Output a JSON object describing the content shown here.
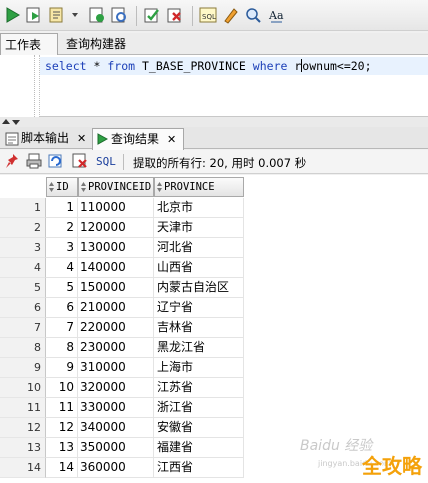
{
  "toolbar": {
    "icons": [
      "run-statement-icon",
      "run-script-icon",
      "explain-plan-icon",
      "autotrace-icon",
      "sql-tuning-icon",
      "commit-icon",
      "rollback-icon",
      "sql-history-icon",
      "clear-icon",
      "find-icon",
      "case-icon"
    ]
  },
  "editor_tabs": [
    {
      "label": "工作表"
    },
    {
      "label": "查询构建器"
    }
  ],
  "editor": {
    "kw_select": "select",
    "star": "*",
    "kw_from": "from",
    "table": "T_BASE_PROVINCE",
    "kw_where": "where",
    "cond_pre": "r",
    "cond_post": "ownum<=20;"
  },
  "output_tabs": [
    {
      "label": "脚本输出",
      "closable": true
    },
    {
      "label": "查询结果",
      "closable": true
    }
  ],
  "result_toolbar": {
    "sql_label": "SQL",
    "status": "提取的所有行: 20, 用时 0.007 秒"
  },
  "grid": {
    "columns": [
      "ID",
      "PROVINCEID",
      "PROVINCE"
    ],
    "rows": [
      {
        "n": "1",
        "id": "1",
        "pid": "110000",
        "name": "北京市"
      },
      {
        "n": "2",
        "id": "2",
        "pid": "120000",
        "name": "天津市"
      },
      {
        "n": "3",
        "id": "3",
        "pid": "130000",
        "name": "河北省"
      },
      {
        "n": "4",
        "id": "4",
        "pid": "140000",
        "name": "山西省"
      },
      {
        "n": "5",
        "id": "5",
        "pid": "150000",
        "name": "内蒙古自治区"
      },
      {
        "n": "6",
        "id": "6",
        "pid": "210000",
        "name": "辽宁省"
      },
      {
        "n": "7",
        "id": "7",
        "pid": "220000",
        "name": "吉林省"
      },
      {
        "n": "8",
        "id": "8",
        "pid": "230000",
        "name": "黑龙江省"
      },
      {
        "n": "9",
        "id": "9",
        "pid": "310000",
        "name": "上海市"
      },
      {
        "n": "10",
        "id": "10",
        "pid": "320000",
        "name": "江苏省"
      },
      {
        "n": "11",
        "id": "11",
        "pid": "330000",
        "name": "浙江省"
      },
      {
        "n": "12",
        "id": "12",
        "pid": "340000",
        "name": "安徽省"
      },
      {
        "n": "13",
        "id": "13",
        "pid": "350000",
        "name": "福建省"
      },
      {
        "n": "14",
        "id": "14",
        "pid": "360000",
        "name": "江西省"
      }
    ]
  },
  "watermark": {
    "brand": "Baidu 经验",
    "url": "jingyan.baidu.com",
    "logo_text": "全攻略"
  }
}
